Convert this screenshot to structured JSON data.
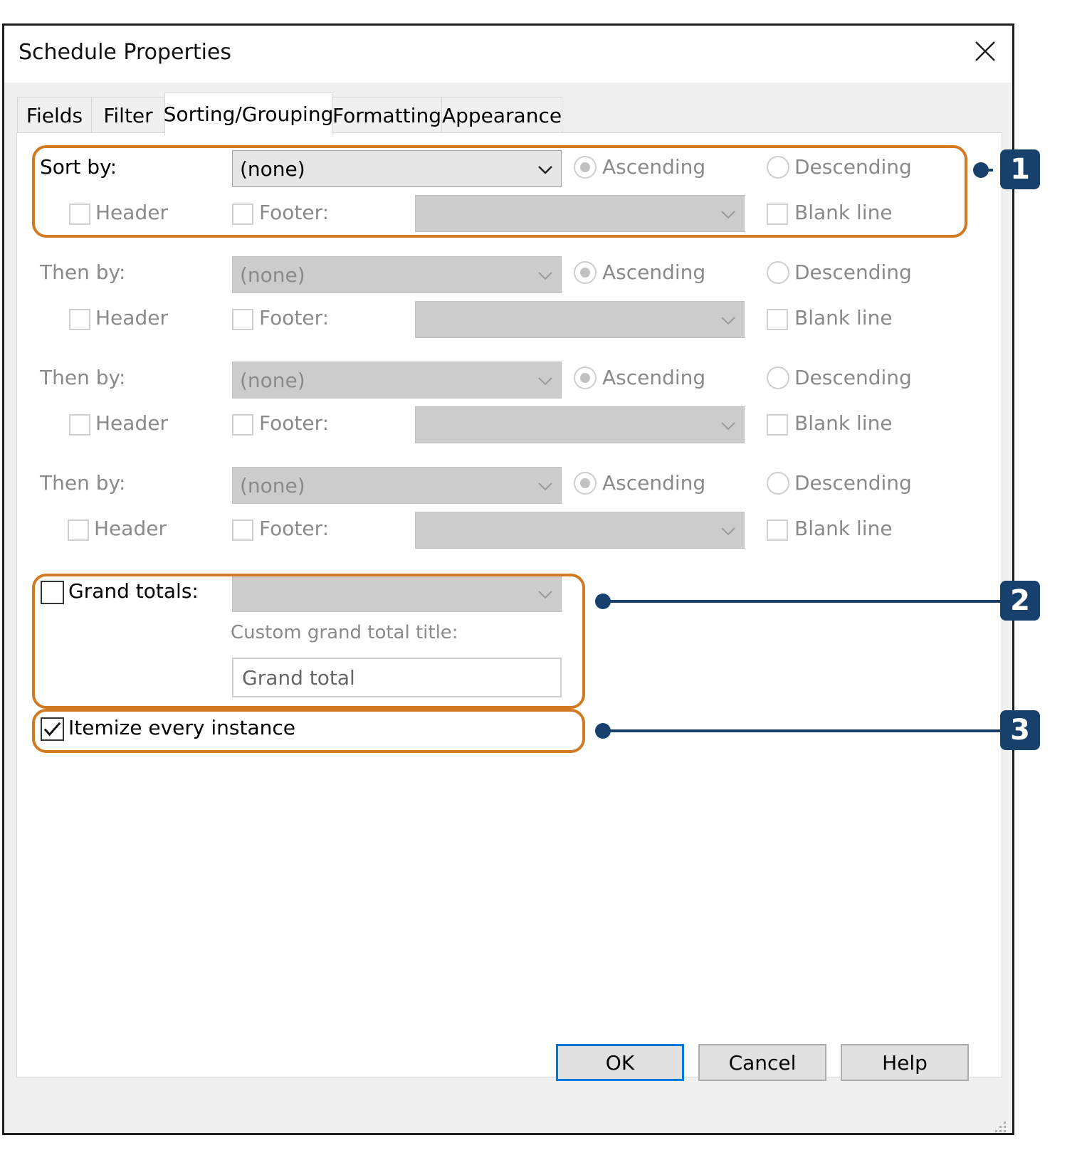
{
  "window": {
    "title": "Schedule Properties"
  },
  "tabs": [
    {
      "label": "Fields",
      "active": false
    },
    {
      "label": "Filter",
      "active": false
    },
    {
      "label": "Sorting/Grouping",
      "active": true
    },
    {
      "label": "Formatting",
      "active": false
    },
    {
      "label": "Appearance",
      "active": false
    }
  ],
  "sort_rows": [
    {
      "label": "Sort by:",
      "field": "(none)",
      "enabled": true,
      "ascending": "Ascending",
      "descending": "Descending",
      "header": "Header",
      "footer": "Footer:",
      "footer_value": "",
      "blank_line": "Blank line"
    },
    {
      "label": "Then by:",
      "field": "(none)",
      "enabled": false,
      "ascending": "Ascending",
      "descending": "Descending",
      "header": "Header",
      "footer": "Footer:",
      "footer_value": "",
      "blank_line": "Blank line"
    },
    {
      "label": "Then by:",
      "field": "(none)",
      "enabled": false,
      "ascending": "Ascending",
      "descending": "Descending",
      "header": "Header",
      "footer": "Footer:",
      "footer_value": "",
      "blank_line": "Blank line"
    },
    {
      "label": "Then by:",
      "field": "(none)",
      "enabled": false,
      "ascending": "Ascending",
      "descending": "Descending",
      "header": "Header",
      "footer": "Footer:",
      "footer_value": "",
      "blank_line": "Blank line"
    }
  ],
  "grand_totals": {
    "label": "Grand totals:",
    "checked": false,
    "custom_title_label": "Custom grand total title:",
    "custom_title_value": "Grand total"
  },
  "itemize": {
    "label": "Itemize every instance",
    "checked": true
  },
  "buttons": {
    "ok": "OK",
    "cancel": "Cancel",
    "help": "Help"
  },
  "callouts": [
    "1",
    "2",
    "3"
  ],
  "colors": {
    "callout_border": "#d17a22",
    "badge": "#17406d",
    "ok_border": "#0078d7"
  }
}
